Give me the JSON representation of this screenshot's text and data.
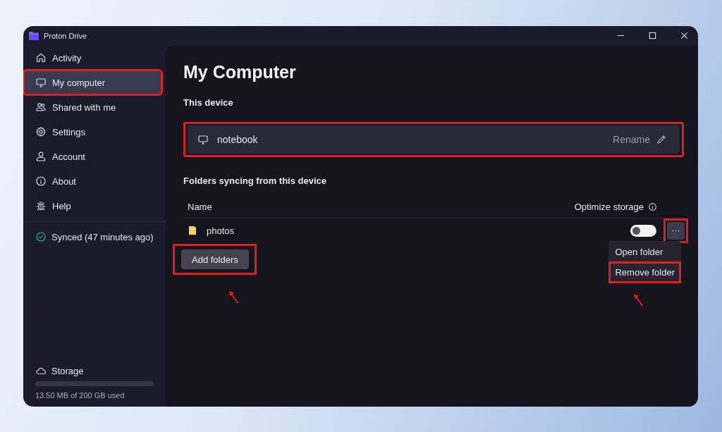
{
  "window": {
    "title": "Proton Drive"
  },
  "sidebar": {
    "items": [
      {
        "label": "Activity",
        "selected": false,
        "highlighted": false
      },
      {
        "label": "My computer",
        "selected": true,
        "highlighted": true
      },
      {
        "label": "Shared with me",
        "selected": false,
        "highlighted": false
      },
      {
        "label": "Settings",
        "selected": false,
        "highlighted": false
      },
      {
        "label": "Account",
        "selected": false,
        "highlighted": false
      },
      {
        "label": "About",
        "selected": false,
        "highlighted": false
      },
      {
        "label": "Help",
        "selected": false,
        "highlighted": false
      }
    ],
    "sync_status": "Synced (47 minutes ago)",
    "storage": {
      "label": "Storage",
      "level": 0.0001,
      "usage": "13.50 MB of 200 GB used"
    }
  },
  "main": {
    "title": "My Computer",
    "device_section": "This device",
    "device": {
      "name": "notebook",
      "action": "Rename",
      "highlighted": true
    },
    "folders_section": "Folders syncing from this device",
    "table": {
      "columns": [
        "Name",
        "Optimize storage"
      ],
      "rows": [
        {
          "name": "photos",
          "optimize_on": false,
          "more_label": "···",
          "more_highlighted": true
        }
      ]
    },
    "add_button": {
      "label": "Add folders",
      "highlighted": true
    },
    "context_menu": [
      {
        "label": "Open folder",
        "highlighted": false
      },
      {
        "label": "Remove folder",
        "highlighted": true
      }
    ]
  }
}
